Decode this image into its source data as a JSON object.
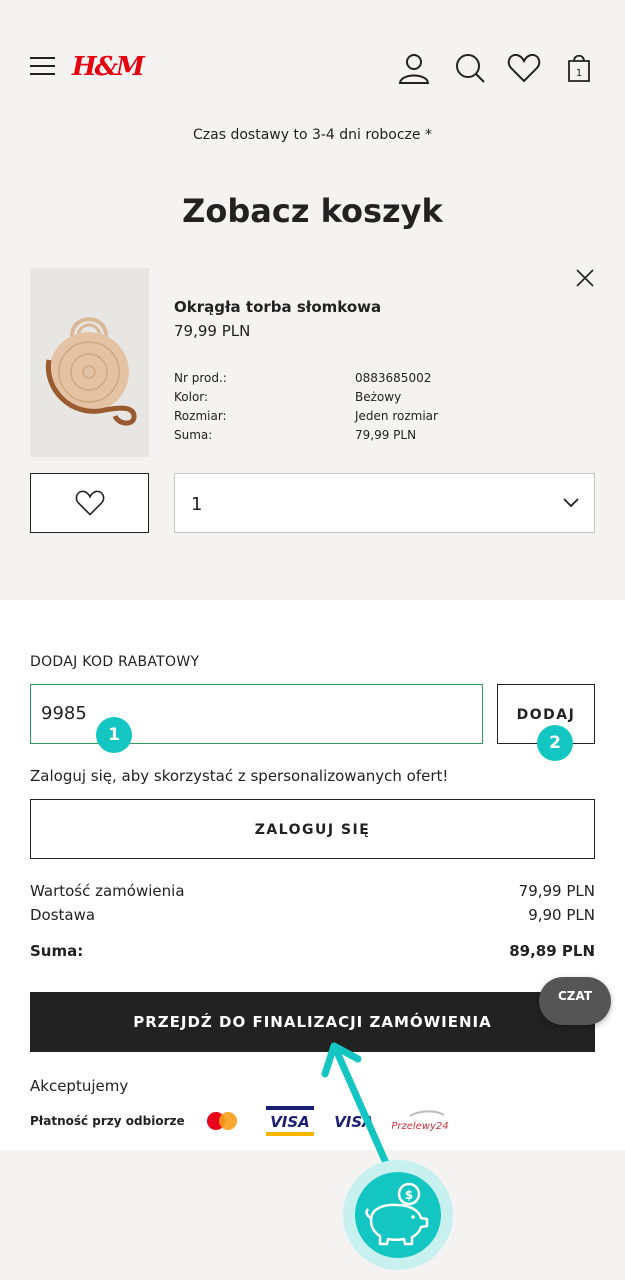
{
  "header": {
    "logo": "H&M",
    "icons": [
      "menu-icon",
      "account-icon",
      "search-icon",
      "heart-icon",
      "bag-icon"
    ],
    "bag_count": "1"
  },
  "delivery_note": "Czas dostawy to 3-4 dni robocze *",
  "page_title": "Zobacz koszyk",
  "product": {
    "name": "Okrągła torba słomkowa",
    "price": "79,99 PLN",
    "details": [
      {
        "label": "Nr prod.:",
        "value": "0883685002"
      },
      {
        "label": "Kolor:",
        "value": "Beżowy"
      },
      {
        "label": "Rozmiar:",
        "value": "Jeden rozmiar"
      },
      {
        "label": "Suma:",
        "value": "79,99 PLN"
      }
    ],
    "quantity": "1"
  },
  "promo": {
    "label": "DODAJ KOD RABATOWY",
    "value": "9985",
    "button": "DODAJ",
    "badge_input": "1",
    "badge_button": "2"
  },
  "login": {
    "hint": "Zaloguj się, aby skorzystać z spersonalizowanych ofert!",
    "button": "ZALOGUJ SIĘ"
  },
  "summary": {
    "order_value_label": "Wartość zamówienia",
    "order_value": "79,99 PLN",
    "delivery_label": "Dostawa",
    "delivery": "9,90 PLN",
    "total_label": "Suma:",
    "total": "89,89 PLN"
  },
  "checkout_button": "PRZEJDŹ DO FINALIZACJI ZAMÓWIENIA",
  "chat_button": "CZAT",
  "payments": {
    "accept_label": "Akceptujemy",
    "cod_label": "Płatność przy odbiorze",
    "visa_label": "VISA",
    "p24_label": "Przelewy24"
  },
  "colors": {
    "brand_red": "#e50010",
    "accent_teal": "#14c6c2",
    "dark": "#222222",
    "focus_green": "#2e9e5a"
  }
}
